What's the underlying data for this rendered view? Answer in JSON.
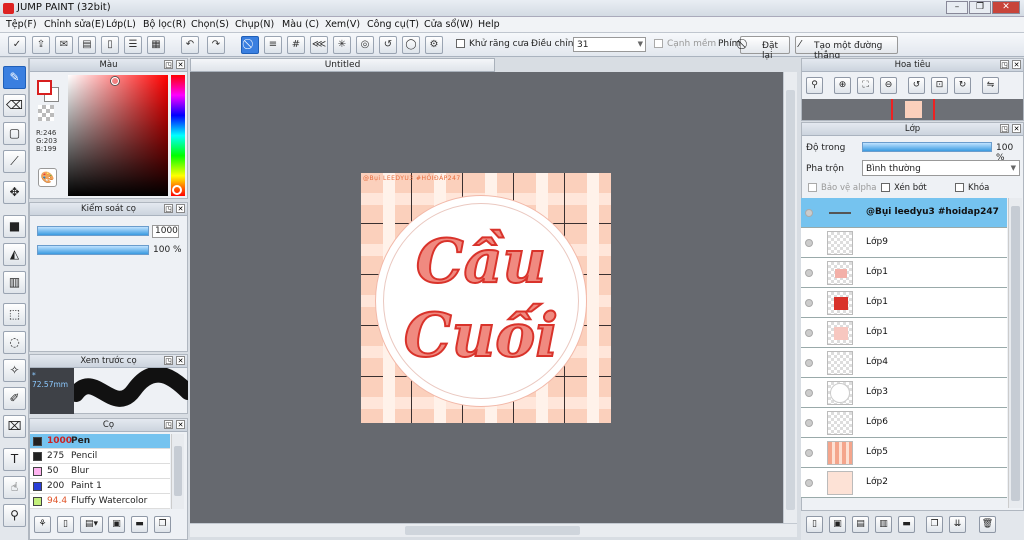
{
  "app": {
    "title": "JUMP PAINT (32bit)"
  },
  "menu": [
    "Tệp(F)",
    "Chỉnh sửa(E)",
    "Lớp(L)",
    "Bộ lọc(R)",
    "Chọn(S)",
    "Chụp(N)",
    "Màu (C)",
    "Xem(V)",
    "Công cụ(T)",
    "Cửa sổ(W)",
    "Help"
  ],
  "toolbar": {
    "antialias_label": "Khử răng cưa",
    "adjust_label": "Điều chỉnh",
    "adjust_value": "31",
    "edge_label": "Cạnh mềm",
    "key_label": "Phím",
    "reset_label": "Đặt lại",
    "straight_label": "Tạo một đường thẳng"
  },
  "color_panel": {
    "title": "Màu",
    "rgb": [
      "R:246",
      "G:203",
      "B:199"
    ],
    "fg_color": "#f6cbc7",
    "accent": "#d81f1f"
  },
  "brush_control": {
    "title": "Kiểm soát cọ",
    "size_value": "1000",
    "opacity_value": "100 %"
  },
  "brush_preview": {
    "title": "Xem trước cọ",
    "size_label": "* 72.57mm"
  },
  "brushes": {
    "title": "Cọ",
    "items": [
      {
        "size": "1000",
        "name": "Pen",
        "color": "#222222"
      },
      {
        "size": "275",
        "name": "Pencil",
        "color": "#222222"
      },
      {
        "size": "50",
        "name": "Blur",
        "color": "#ffb3f0"
      },
      {
        "size": "200",
        "name": "Paint 1",
        "color": "#2a3fd8"
      },
      {
        "size": "94.4",
        "name": "Fluffy Watercolor",
        "color": "#c3f07a"
      }
    ]
  },
  "document": {
    "tab": "Untitled",
    "watermark": "@Bụi LEEDYU3 #HỎIĐÁP247",
    "artwork_line1": "Cầu",
    "artwork_line2": "Cuối",
    "artwork_color": "#e8453a"
  },
  "navigator": {
    "title": "Hoa tiêu"
  },
  "layers": {
    "title": "Lớp",
    "opacity_label": "Độ trong",
    "opacity_value": "100 %",
    "blend_label": "Pha trộn",
    "blend_value": "Bình thường",
    "protect_alpha": "Bảo vệ alpha",
    "clip": "Xén bớt",
    "lock": "Khóa",
    "items": [
      {
        "name": "@Bụi leedyu3 #hoidap247",
        "selected": true
      },
      {
        "name": "Lớp9",
        "selected": false
      },
      {
        "name": "Lớp1",
        "selected": false
      },
      {
        "name": "Lớp1",
        "selected": false
      },
      {
        "name": "Lớp1",
        "selected": false
      },
      {
        "name": "Lớp4",
        "selected": false
      },
      {
        "name": "Lớp3",
        "selected": false
      },
      {
        "name": "Lớp6",
        "selected": false
      },
      {
        "name": "Lớp5",
        "selected": false
      },
      {
        "name": "Lớp2",
        "selected": false
      }
    ]
  }
}
